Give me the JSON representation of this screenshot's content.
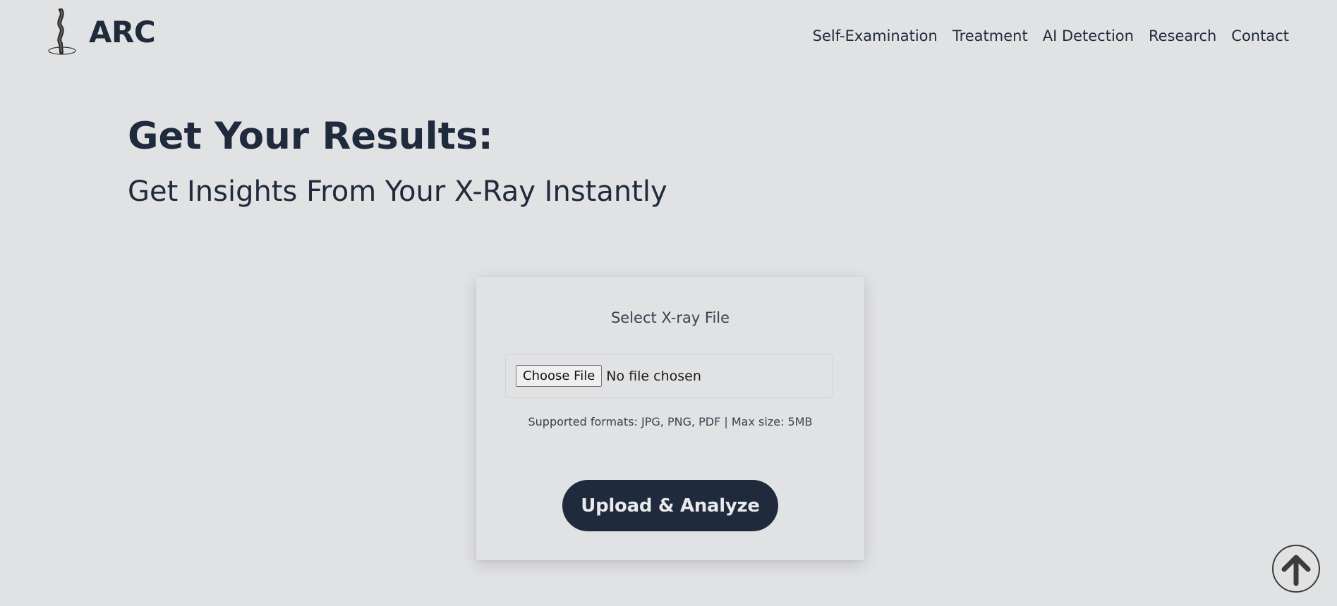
{
  "header": {
    "brand": "ARC",
    "logo_icon": "spine-icon",
    "nav": [
      {
        "label": "Self-Examination"
      },
      {
        "label": "Treatment"
      },
      {
        "label": "AI Detection"
      },
      {
        "label": "Research"
      },
      {
        "label": "Contact"
      }
    ]
  },
  "hero": {
    "title": "Get Your Results:",
    "subtitle": "Get Insights From Your X-Ray Instantly"
  },
  "upload_card": {
    "label": "Select X-ray File",
    "choose_button": "Choose File",
    "file_status": "No file chosen",
    "hint": "Supported formats: JPG, PNG, PDF | Max size: 5MB",
    "submit_label": "Upload & Analyze"
  },
  "scroll_top_icon": "arrow-up-icon",
  "colors": {
    "background": "#e1e2e4",
    "primary": "#1f2a3c",
    "button_text": "#e8e9eb"
  }
}
